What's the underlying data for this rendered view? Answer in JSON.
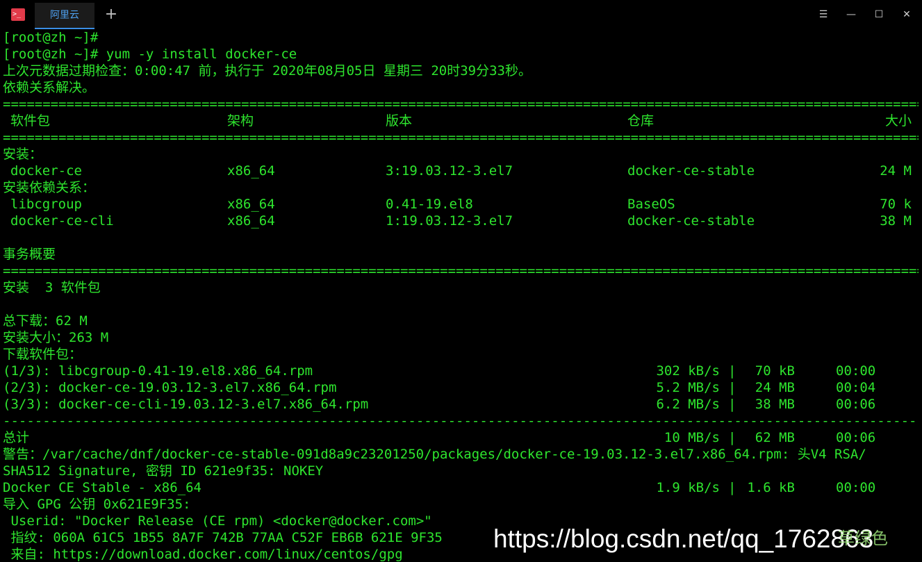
{
  "window": {
    "tab_label": "阿里云",
    "new_tab_glyph": "+",
    "menu_glyph": "☰",
    "minimize_glyph": "—",
    "maximize_glyph": "☐",
    "close_glyph": "✕",
    "app_icon_glyph": ">_"
  },
  "colors": {
    "terminal_text": "#2ee52e",
    "background": "#000000",
    "tab_accent": "#3a8ee6"
  },
  "terminal": {
    "prompt_line_1": "[root@zh ~]#",
    "prompt_line_2": "[root@zh ~]# yum -y install docker-ce",
    "metadata_check": "上次元数据过期检查：0:00:47 前，执行于 2020年08月05日 星期三 20时39分33秒。",
    "resolving_deps": "依赖关系解决。",
    "sep_double": "============================================================================================================================",
    "sep_single": "----------------------------------------------------------------------------------------------------------------------------",
    "table_header": {
      "package": "软件包",
      "arch": "架构",
      "version": "版本",
      "repo": "仓库",
      "size": "大小"
    },
    "installing_label": "安装：",
    "install_packages": [
      {
        "name": "docker-ce",
        "arch": "x86_64",
        "version": "3:19.03.12-3.el7",
        "repo": "docker-ce-stable",
        "size": "24 M"
      }
    ],
    "installing_deps_label": "安装依赖关系：",
    "dep_packages": [
      {
        "name": "libcgroup",
        "arch": "x86_64",
        "version": "0.41-19.el8",
        "repo": "BaseOS",
        "size": "70 k"
      },
      {
        "name": "docker-ce-cli",
        "arch": "x86_64",
        "version": "1:19.03.12-3.el7",
        "repo": "docker-ce-stable",
        "size": "38 M"
      }
    ],
    "transaction_summary": "事务概要",
    "install_count": "安装  3 软件包",
    "total_download": "总下载：62 M",
    "install_size": "安装大小：263 M",
    "downloading": "下载软件包：",
    "downloads": [
      {
        "file": "(1/3): libcgroup-0.41-19.el8.x86_64.rpm",
        "speed": "302 kB/s",
        "size": "70 kB",
        "time": "00:00"
      },
      {
        "file": "(2/3): docker-ce-19.03.12-3.el7.x86_64.rpm",
        "speed": "5.2 MB/s",
        "size": "24 MB",
        "time": "00:04"
      },
      {
        "file": "(3/3): docker-ce-cli-19.03.12-3.el7.x86_64.rpm",
        "speed": "6.2 MB/s",
        "size": "38 MB",
        "time": "00:06"
      }
    ],
    "total_row": {
      "label": "总计",
      "speed": "10 MB/s",
      "size": "62 MB",
      "time": "00:06"
    },
    "warning_line": "警告：/var/cache/dnf/docker-ce-stable-091d8a9c23201250/packages/docker-ce-19.03.12-3.el7.x86_64.rpm: 头V4 RSA/",
    "signature_line": "SHA512 Signature, 密钥 ID 621e9f35: NOKEY",
    "docker_repo_row": {
      "label": "Docker CE Stable - x86_64",
      "speed": "1.9 kB/s",
      "size": "1.6 kB",
      "time": "00:00"
    },
    "import_gpg": "导入 GPG 公钥 0x621E9F35:",
    "userid_line": " Userid: \"Docker Release (CE rpm) <docker@docker.com>\"",
    "fingerprint_line": " 指纹: 060A 61C5 1B55 8A7F 742B 77AA C52F EB6B 621E 9F35",
    "from_line": " 来自: https://download.docker.com/linux/centos/gpg"
  },
  "watermark": {
    "text": "https://blog.csdn.net/qq_1762863",
    "logo_text": "草绿色"
  }
}
